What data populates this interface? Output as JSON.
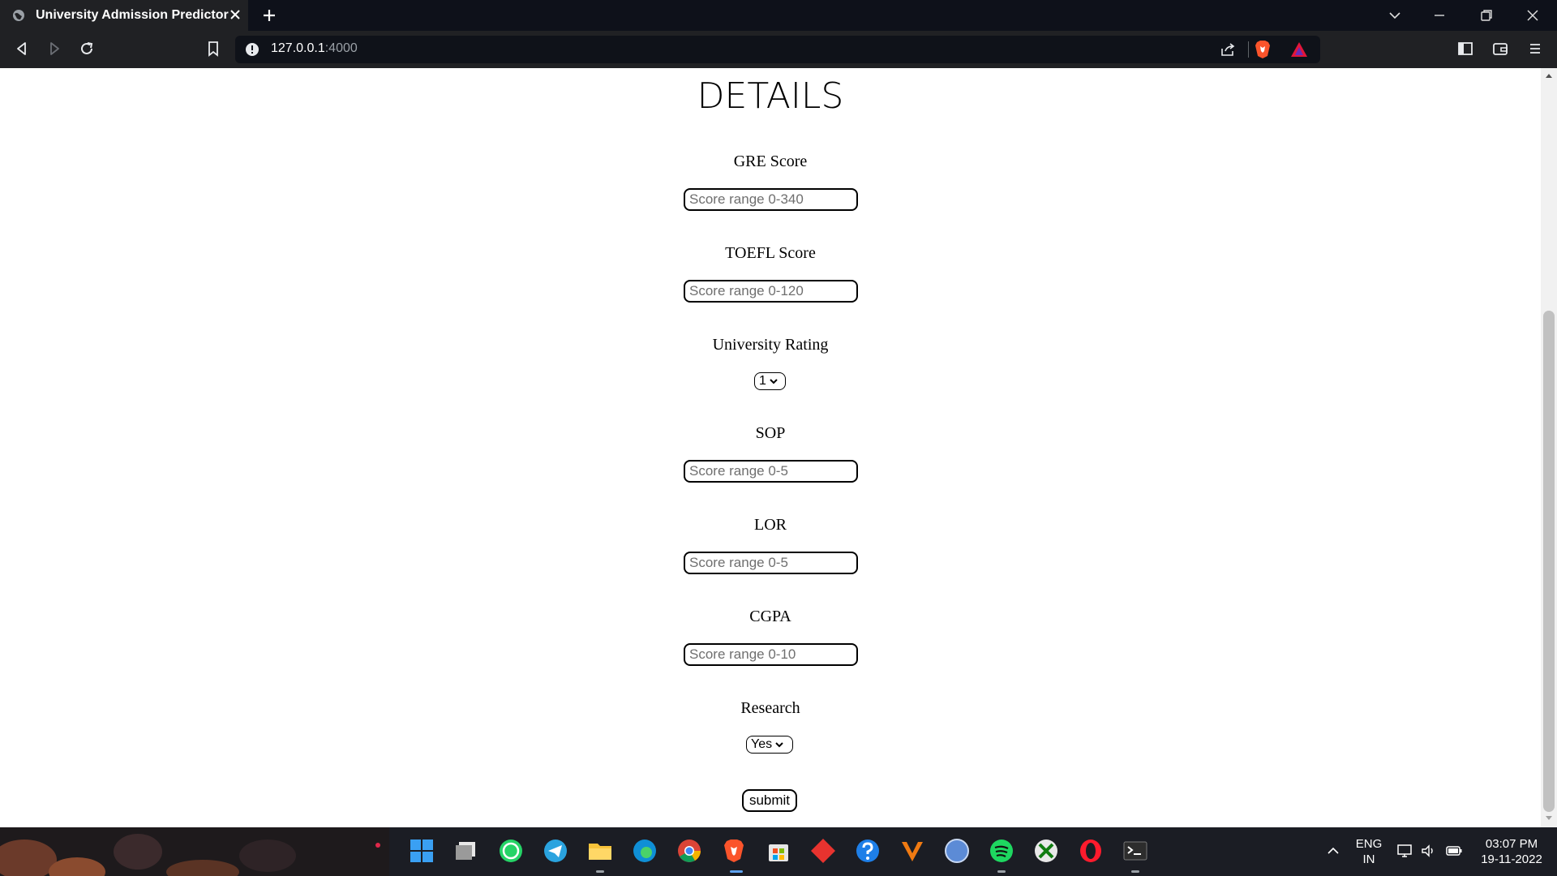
{
  "browser": {
    "tab_title": "University Admission Predictor",
    "url_host": "127.0.0.1",
    "url_port": ":4000"
  },
  "page": {
    "title": "DETAILS",
    "fields": [
      {
        "label": "GRE Score",
        "placeholder": "Score range 0-340"
      },
      {
        "label": "TOEFL Score",
        "placeholder": "Score range 0-120"
      },
      {
        "label": "University Rating",
        "selected": "1"
      },
      {
        "label": "SOP",
        "placeholder": "Score range 0-5"
      },
      {
        "label": "LOR",
        "placeholder": "Score range 0-5"
      },
      {
        "label": "CGPA",
        "placeholder": "Score range 0-10"
      },
      {
        "label": "Research",
        "selected": "Yes"
      }
    ],
    "submit_label": "submit"
  },
  "taskbar": {
    "language": "ENG",
    "region": "IN",
    "time": "03:07 PM",
    "date": "19-11-2022",
    "apps": [
      "start-icon",
      "task-view-icon",
      "whatsapp-icon",
      "telegram-icon",
      "file-explorer-icon",
      "edge-icon",
      "chrome-icon",
      "brave-icon",
      "microsoft-store-icon",
      "red-diamond-app-icon",
      "help-icon",
      "vlc-icon",
      "qbittorrent-icon",
      "spotify-icon",
      "xbox-icon",
      "opera-icon",
      "terminal-icon"
    ]
  },
  "colors": {
    "chrome_dark": "#202124",
    "tabbar": "#0e111a",
    "brave_orange": "#fb542b",
    "taskbar": "#1b1d24"
  }
}
